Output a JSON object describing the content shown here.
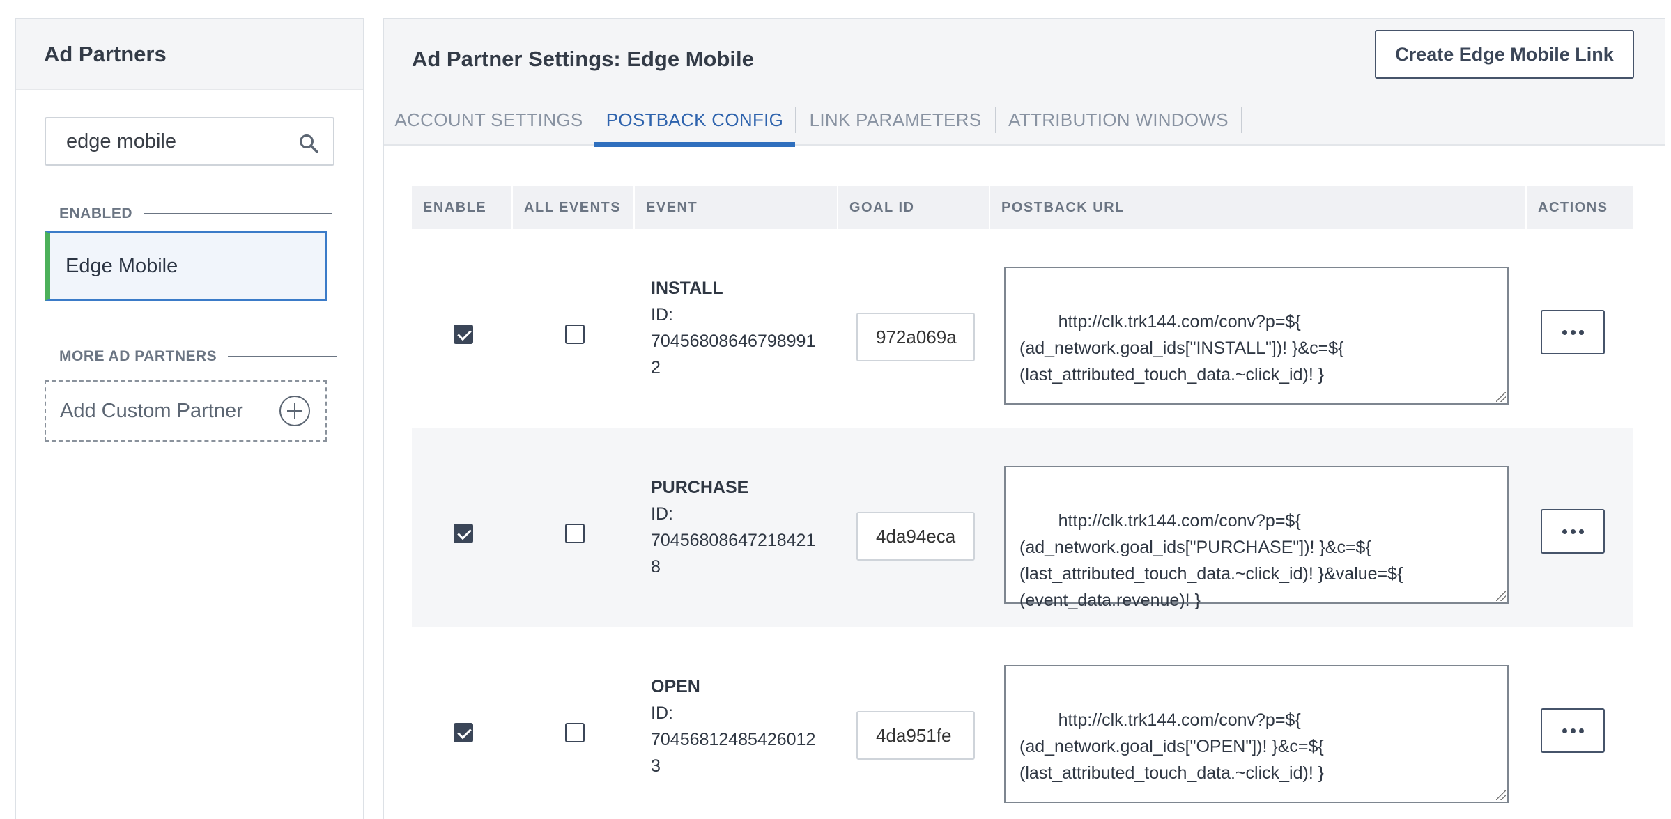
{
  "sidebar": {
    "title": "Ad Partners",
    "search_value": "edge mobile",
    "enabled_label": "ENABLED",
    "enabled_items": [
      {
        "label": "Edge Mobile"
      }
    ],
    "more_label": "MORE AD PARTNERS",
    "add_custom_label": "Add Custom Partner"
  },
  "main": {
    "title": "Ad Partner Settings: Edge Mobile",
    "create_button": "Create Edge Mobile Link",
    "tabs": [
      {
        "label": "ACCOUNT SETTINGS"
      },
      {
        "label": "POSTBACK CONFIG",
        "active": true
      },
      {
        "label": "LINK PARAMETERS"
      },
      {
        "label": "ATTRIBUTION WINDOWS"
      }
    ],
    "table": {
      "headers": [
        "ENABLE",
        "ALL EVENTS",
        "EVENT",
        "GOAL ID",
        "POSTBACK URL",
        "ACTIONS"
      ],
      "rows": [
        {
          "enabled": true,
          "all_events": false,
          "event": "INSTALL",
          "id_label": "ID:",
          "id_line1": "70456808646798991",
          "id_line2": "2",
          "goal_id": "972a069a",
          "postback_url": "http://clk.trk144.com/conv?p=${\n(ad_network.goal_ids[\"INSTALL\"])! }&c=${\n(last_attributed_touch_data.~click_id)! }"
        },
        {
          "enabled": true,
          "all_events": false,
          "event": "PURCHASE",
          "id_label": "ID:",
          "id_line1": "70456808647218421",
          "id_line2": "8",
          "goal_id": "4da94eca",
          "postback_url": "http://clk.trk144.com/conv?p=${\n(ad_network.goal_ids[\"PURCHASE\"])! }&c=${\n(last_attributed_touch_data.~click_id)! }&value=${\n(event_data.revenue)! }"
        },
        {
          "enabled": true,
          "all_events": false,
          "event": "OPEN",
          "id_label": "ID:",
          "id_line1": "70456812485426012",
          "id_line2": "3",
          "goal_id": "4da951fe",
          "postback_url": "http://clk.trk144.com/conv?p=${\n(ad_network.goal_ids[\"OPEN\"])! }&c=${\n(last_attributed_touch_data.~click_id)! }"
        }
      ]
    }
  },
  "icons": {
    "search": "search-icon",
    "add": "plus-circle-icon",
    "actions": "more-horizontal-icon"
  },
  "colors": {
    "accent": "#2f6fbe",
    "enabled_bar": "#4cb05a"
  }
}
